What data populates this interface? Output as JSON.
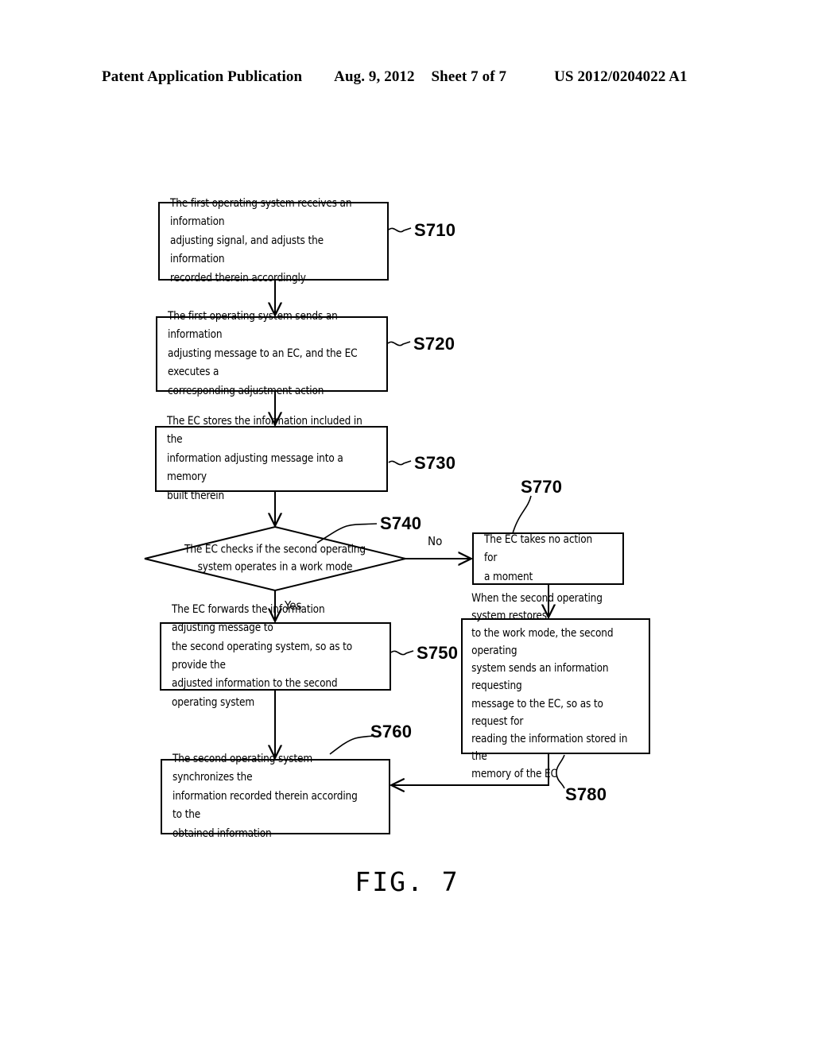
{
  "header": {
    "title": "Patent Application Publication",
    "date": "Aug. 9, 2012",
    "sheet": "Sheet 7 of 7",
    "publication_number": "US 2012/0204022 A1"
  },
  "figure": {
    "caption": "FIG. 7"
  },
  "flowchart": {
    "type": "flowchart",
    "nodes": [
      {
        "id": "S710",
        "shape": "process",
        "tag": "S710",
        "text": "The first operating system receives an information\nadjusting signal, and adjusts the information\nrecorded therein accordingly"
      },
      {
        "id": "S720",
        "shape": "process",
        "tag": "S720",
        "text": "The first operating system sends an information\nadjusting message to an EC, and the EC executes a\ncorresponding adjustment action"
      },
      {
        "id": "S730",
        "shape": "process",
        "tag": "S730",
        "text": "The EC stores the information included in the\ninformation adjusting message into a memory\nbuilt therein"
      },
      {
        "id": "S740",
        "shape": "decision",
        "tag": "S740",
        "text": "The EC checks if the second operating\nsystem operates in a work mode"
      },
      {
        "id": "S750",
        "shape": "process",
        "tag": "S750",
        "text": "The EC forwards the information adjusting message to\nthe second operating system, so as to provide the\nadjusted information to the second operating system"
      },
      {
        "id": "S760",
        "shape": "process",
        "tag": "S760",
        "text": "The second operating system synchronizes the\ninformation recorded therein according to the\nobtained information"
      },
      {
        "id": "S770",
        "shape": "process",
        "tag": "S770",
        "text": "The EC takes no action for\na moment"
      },
      {
        "id": "S780",
        "shape": "process",
        "tag": "S780",
        "text": "When the second operating system restores\nto the work mode, the second operating\nsystem sends an information requesting\nmessage to the EC, so as to request for\nreading the information stored in the\nmemory of the EC"
      }
    ],
    "branch_labels": {
      "no": "No",
      "yes": "Yes"
    },
    "colors": {
      "stroke": "#000000",
      "background": "#ffffff"
    }
  }
}
